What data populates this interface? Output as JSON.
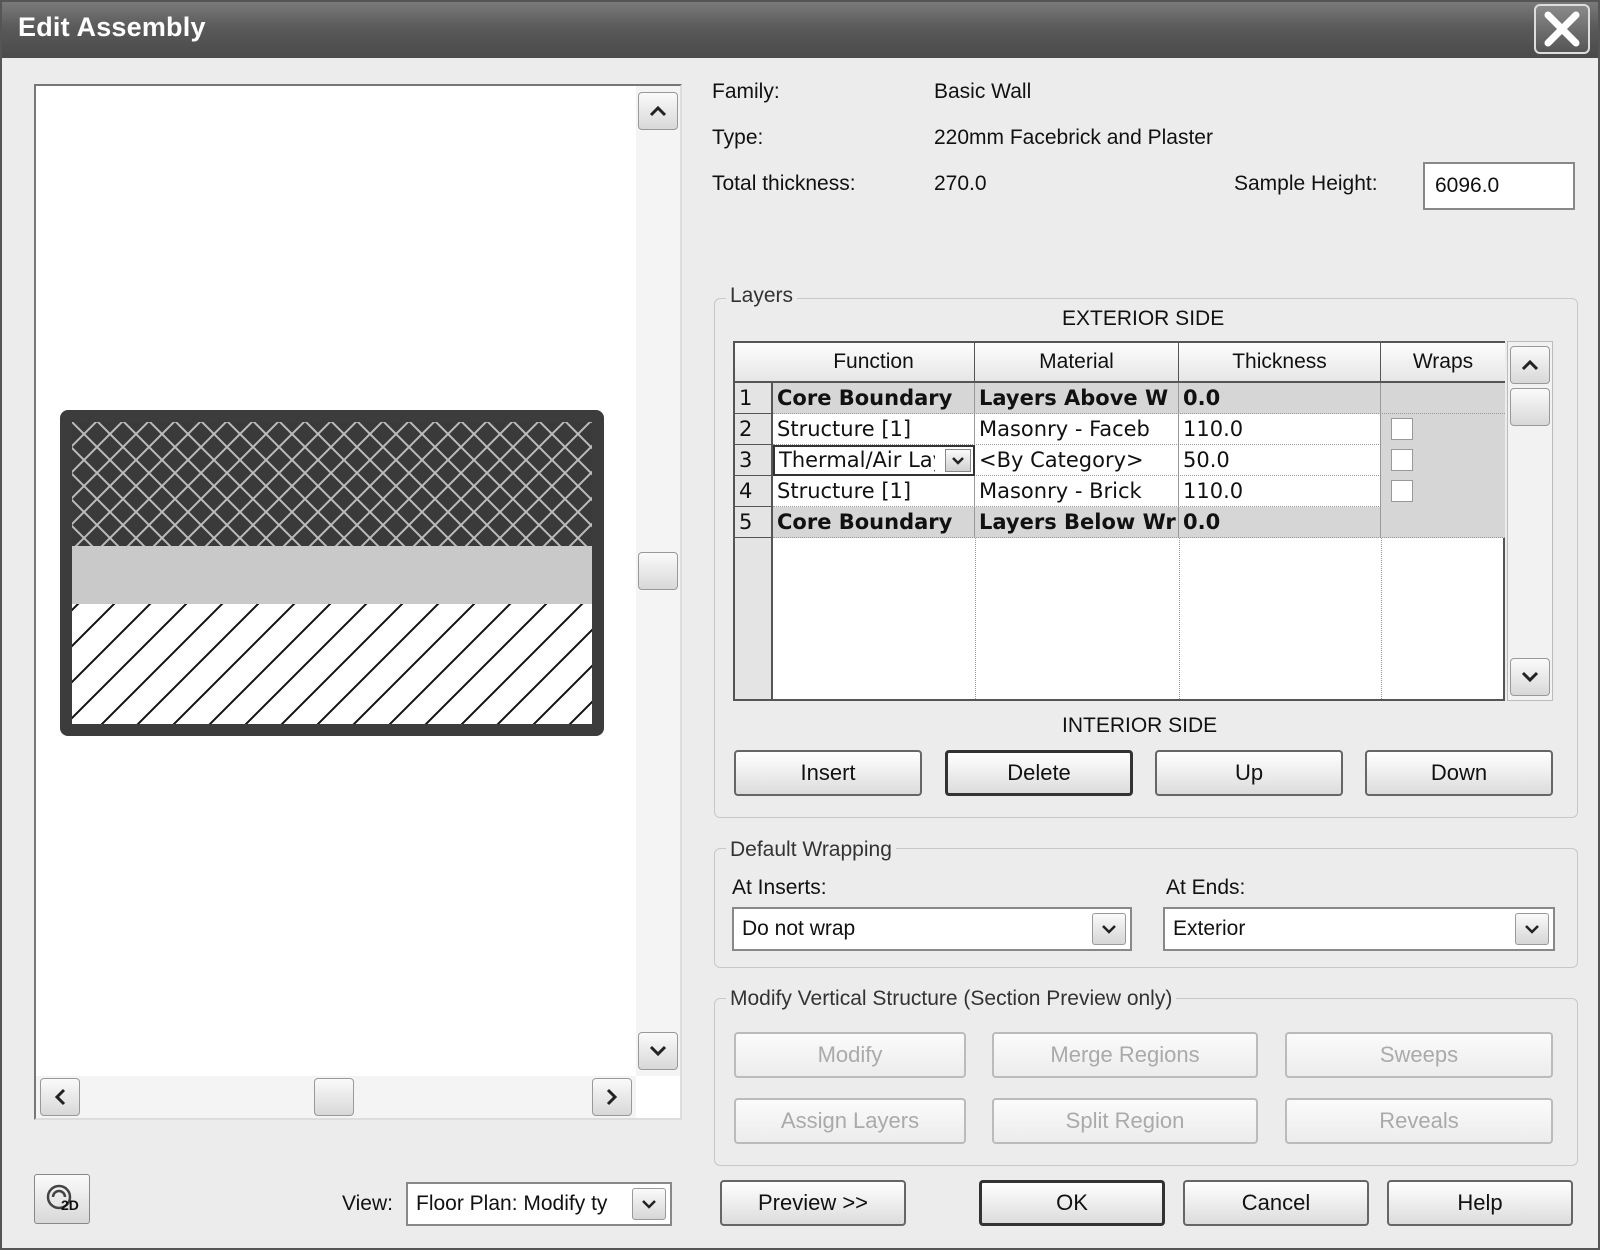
{
  "window": {
    "title": "Edit Assembly"
  },
  "info": {
    "family_label": "Family:",
    "family_value": "Basic Wall",
    "type_label": "Type:",
    "type_value": "220mm Facebrick and Plaster",
    "thickness_label": "Total thickness:",
    "thickness_value": "270.0",
    "sample_height_label": "Sample Height:",
    "sample_height_value": "6096.0"
  },
  "layers": {
    "group_title": "Layers",
    "exterior_label": "EXTERIOR SIDE",
    "interior_label": "INTERIOR SIDE",
    "columns": [
      "Function",
      "Material",
      "Thickness",
      "Wraps"
    ],
    "rows": [
      {
        "num": "1",
        "function": "Core Boundary",
        "material": "Layers Above W",
        "thickness": "0.0",
        "boundary": true
      },
      {
        "num": "2",
        "function": "Structure [1]",
        "material": "Masonry - Faceb",
        "thickness": "110.0",
        "boundary": false
      },
      {
        "num": "3",
        "function": "Thermal/Air Lay",
        "material": "<By Category>",
        "thickness": "50.0",
        "boundary": false
      },
      {
        "num": "4",
        "function": "Structure [1]",
        "material": "Masonry - Brick",
        "thickness": "110.0",
        "boundary": false
      },
      {
        "num": "5",
        "function": "Core Boundary",
        "material": "Layers Below Wr",
        "thickness": "0.0",
        "boundary": true
      }
    ],
    "buttons": {
      "insert": "Insert",
      "delete": "Delete",
      "up": "Up",
      "down": "Down"
    }
  },
  "wrapping": {
    "group_title": "Default Wrapping",
    "inserts_label": "At Inserts:",
    "inserts_value": "Do not wrap",
    "ends_label": "At  Ends:",
    "ends_value": "Exterior"
  },
  "vertical": {
    "group_title": "Modify Vertical Structure (Section Preview only)",
    "buttons": {
      "modify": "Modify",
      "merge": "Merge Regions",
      "sweeps": "Sweeps",
      "assign": "Assign Layers",
      "split": "Split Region",
      "reveals": "Reveals"
    }
  },
  "footer": {
    "view_label": "View:",
    "view_value": "Floor Plan: Modify ty",
    "preview": "Preview >>",
    "ok": "OK",
    "cancel": "Cancel",
    "help": "Help",
    "twod_badge": "2D"
  },
  "icons": [
    "close-icon",
    "scroll-up-icon",
    "scroll-down-icon",
    "scroll-left-icon",
    "scroll-right-icon",
    "dropdown-arrow-icon",
    "view-2d-icon"
  ]
}
